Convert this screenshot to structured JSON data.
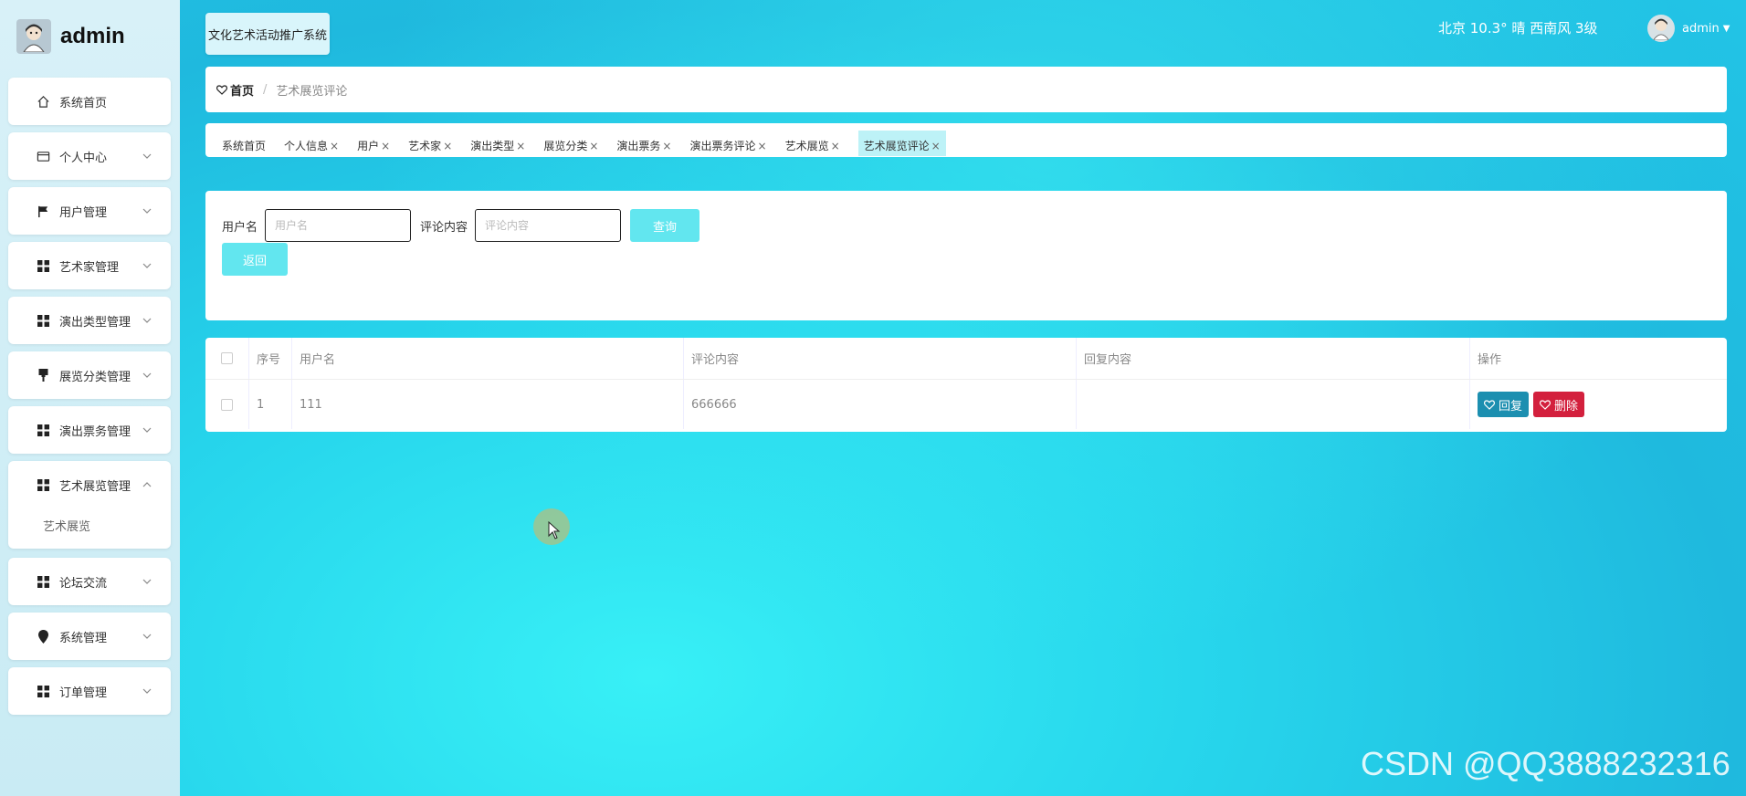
{
  "brand": {
    "name": "admin"
  },
  "sidebar": {
    "items": [
      {
        "label": "系统首页",
        "icon": "home-icon",
        "has_chevron": false
      },
      {
        "label": "个人中心",
        "icon": "id-card-icon",
        "has_chevron": true
      },
      {
        "label": "用户管理",
        "icon": "flag-icon",
        "has_chevron": true
      },
      {
        "label": "艺术家管理",
        "icon": "grid-icon",
        "has_chevron": true
      },
      {
        "label": "演出类型管理",
        "icon": "grid-icon",
        "has_chevron": true
      },
      {
        "label": "展览分类管理",
        "icon": "brush-icon",
        "has_chevron": true
      },
      {
        "label": "演出票务管理",
        "icon": "grid-icon",
        "has_chevron": true
      },
      {
        "label": "艺术展览管理",
        "icon": "grid-icon",
        "has_chevron": true,
        "expanded": true,
        "sub": [
          "艺术展览"
        ]
      },
      {
        "label": "论坛交流",
        "icon": "grid-icon",
        "has_chevron": true
      },
      {
        "label": "系统管理",
        "icon": "location-icon",
        "has_chevron": true
      },
      {
        "label": "订单管理",
        "icon": "grid-icon",
        "has_chevron": true
      }
    ]
  },
  "header": {
    "system_title": "文化艺术活动推广系统",
    "weather": "北京  10.3°  晴  西南风  3级",
    "user": "admin"
  },
  "breadcrumb": {
    "home": "首页",
    "separator": "/",
    "current": "艺术展览评论"
  },
  "tags": [
    {
      "label": "系统首页",
      "closable": false
    },
    {
      "label": "个人信息",
      "closable": true
    },
    {
      "label": "用户",
      "closable": true
    },
    {
      "label": "艺术家",
      "closable": true
    },
    {
      "label": "演出类型",
      "closable": true
    },
    {
      "label": "展览分类",
      "closable": true
    },
    {
      "label": "演出票务",
      "closable": true
    },
    {
      "label": "演出票务评论",
      "closable": true
    },
    {
      "label": "艺术展览",
      "closable": true
    },
    {
      "label": "艺术展览评论",
      "closable": true,
      "active": true
    }
  ],
  "search": {
    "username_label": "用户名",
    "username_placeholder": "用户名",
    "comment_label": "评论内容",
    "comment_placeholder": "评论内容",
    "query_button": "查询",
    "back_button": "返回"
  },
  "table": {
    "headers": [
      "序号",
      "用户名",
      "评论内容",
      "回复内容",
      "操作"
    ],
    "rows": [
      {
        "index": "1",
        "username": "111",
        "comment": "666666",
        "reply": ""
      }
    ],
    "reply_button": "回复",
    "delete_button": "删除"
  },
  "watermark": "CSDN @QQ3888232316",
  "colors": {
    "accent": "#62e6ef",
    "reply": "#1c8fb0",
    "delete": "#d3203d",
    "main_bg": "#27d6ec"
  }
}
